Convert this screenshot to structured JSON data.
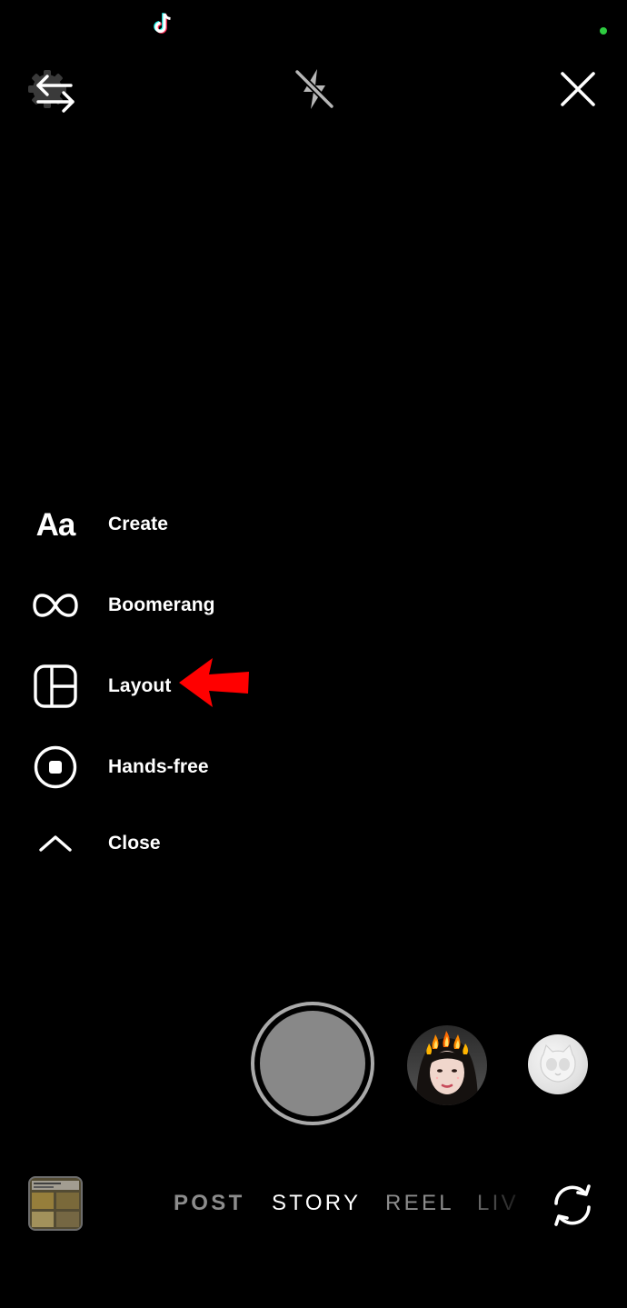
{
  "status_bar": {
    "notification_icon": "tiktok-icon",
    "camera_indicator_color": "#2ecc40"
  },
  "top_bar": {
    "left_icon": "settings-swap-icon",
    "center_icon": "flash-off-icon",
    "right_icon": "close-icon"
  },
  "menu": {
    "items": [
      {
        "label": "Create",
        "icon": "Aa"
      },
      {
        "label": "Boomerang",
        "icon": "infinity-icon"
      },
      {
        "label": "Layout",
        "icon": "layout-grid-icon"
      },
      {
        "label": "Hands-free",
        "icon": "hands-free-icon"
      },
      {
        "label": "Close",
        "icon": "chevron-up-icon"
      }
    ],
    "annotation_color": "#ff0000"
  },
  "capture": {
    "shutter_icon": "shutter-button",
    "effects": [
      "fire-face-effect",
      "cat-face-effect"
    ]
  },
  "modes": {
    "items": [
      "POST",
      "STORY",
      "REEL",
      "LIV"
    ],
    "selected": "STORY"
  },
  "bottom_bar": {
    "gallery_icon": "gallery-thumbnail",
    "flip_icon": "flip-camera-icon"
  }
}
